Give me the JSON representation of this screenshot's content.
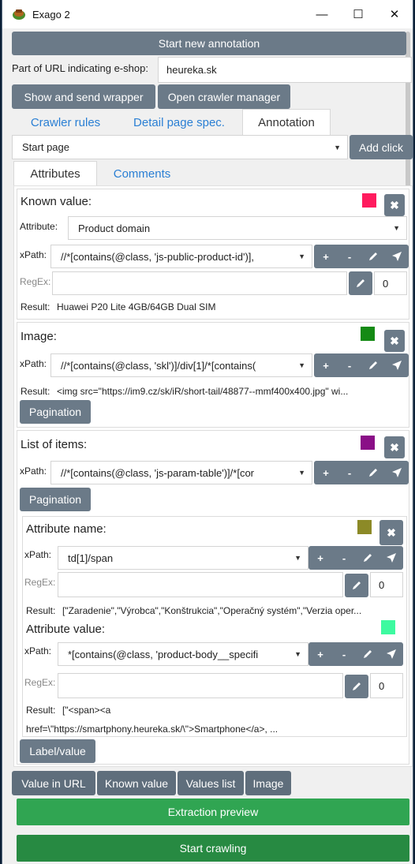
{
  "window": {
    "title": "Exago 2",
    "controls": {
      "minimize": "—",
      "maximize": "☐",
      "close": "✕"
    }
  },
  "buttons": {
    "start_new_annotation": "Start new annotation",
    "show_send_wrapper": "Show and send wrapper",
    "open_crawler_manager": "Open crawler manager",
    "add_click": "Add click",
    "pagination": "Pagination",
    "label_value": "Label/value",
    "extraction_preview": "Extraction preview",
    "start_crawling": "Start crawling"
  },
  "url_field": {
    "label": "Part of URL indicating e-shop:",
    "value": "heureka.sk"
  },
  "main_tabs": [
    {
      "label": "Crawler rules"
    },
    {
      "label": "Detail page spec."
    },
    {
      "label": "Annotation"
    }
  ],
  "page_select": {
    "value": "Start page"
  },
  "sub_tabs": [
    {
      "label": "Attributes"
    },
    {
      "label": "Comments"
    }
  ],
  "labels": {
    "attribute": "Attribute:",
    "xpath": "xPath:",
    "regex": "RegEx:",
    "result": "Result:"
  },
  "tools": {
    "plus": "+",
    "minus": "-"
  },
  "known_value": {
    "title": "Known value:",
    "color": "#ff1b5e",
    "attribute": "Product domain",
    "xpath": "//*[contains(@class, 'js-public-product-id')],",
    "regex_num": "0",
    "result": "Huawei P20 Lite 4GB/64GB Dual SIM"
  },
  "image": {
    "title": "Image:",
    "color": "#148a14",
    "xpath": "//*[contains(@class, 'skl')]/div[1]/*[contains(",
    "result": "<img src=\"https://im9.cz/sk/iR/short-tail/48877--mmf400x400.jpg\" wi..."
  },
  "list_of_items": {
    "title": "List of items:",
    "color": "#8a0f87",
    "xpath": "//*[contains(@class, 'js-param-table')]/*[cor"
  },
  "attribute_name": {
    "title": "Attribute name:",
    "color": "#8c8a27",
    "xpath": "td[1]/span",
    "regex_num": "0",
    "result": "[\"Zaradenie\",\"Výrobca\",\"Konštrukcia\",\"Operačný systém\",\"Verzia oper..."
  },
  "attribute_value": {
    "title": "Attribute value:",
    "color": "#3dfaa0",
    "xpath": "*[contains(@class, 'product-body__specifi",
    "regex_num": "0",
    "result_line1": "[\"<span><a",
    "result_line2": "href=\\\"https://smartphony.heureka.sk/\\\">Smartphone</a>, ..."
  },
  "bottom_tabs": [
    {
      "label": "Value in URL"
    },
    {
      "label": "Known value"
    },
    {
      "label": "Values list"
    },
    {
      "label": "Image"
    }
  ]
}
